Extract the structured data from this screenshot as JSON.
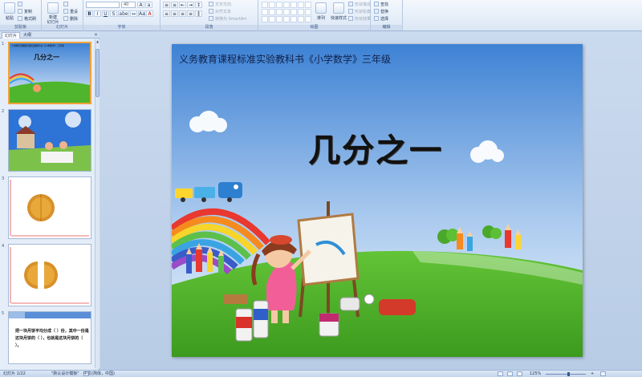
{
  "ribbon": {
    "clipboard": {
      "paste": "粘贴",
      "copy": "复制",
      "format_painter": "格式刷",
      "label": "剪贴板"
    },
    "slides": {
      "new_slide": "新建\n幻灯片",
      "delete": "删除",
      "reset": "重设",
      "label": "幻灯片"
    },
    "font": {
      "size": "40",
      "label": "字体",
      "bold": "B",
      "italic": "I",
      "underline": "U",
      "shadow": "S",
      "strike": "abe",
      "color": "A"
    },
    "paragraph": {
      "text_direction": "文字方向",
      "align_text": "对齐文本",
      "smartart": "转换为 SmartArt",
      "label": "段落"
    },
    "drawing": {
      "arrange": "排列",
      "quick_styles": "快速样式",
      "shape_fill": "形状填充",
      "shape_outline": "形状轮廓",
      "shape_effects": "形状效果",
      "label": "绘图"
    },
    "editing": {
      "find": "查找",
      "replace": "替换",
      "select": "选择",
      "label": "编辑"
    }
  },
  "left_pane": {
    "tab_slides": "幻灯片",
    "tab_outline": "大纲",
    "close": "×",
    "thumbnails": [
      {
        "number": "1",
        "title": "几分之一",
        "subtitle": "义务教育课程标准实验教科书《小学数学》三年级"
      },
      {
        "number": "2"
      },
      {
        "number": "3"
      },
      {
        "number": "4"
      },
      {
        "number": "5",
        "text": "把一块月饼平均分成（ ）份，其中一份是这块月饼的（ ），也就是这块月饼的（ ）。"
      }
    ]
  },
  "slide": {
    "subtitle": "义务教育课程标准实验教科书《小学数学》三年级",
    "title": "几分之一"
  },
  "status_bar": {
    "slide_counter": "幻灯片 1/22",
    "theme": "\"默认设计模板\"",
    "language": "中文(简体，中国)",
    "zoom": "125%"
  },
  "colors": {
    "sky_top": "#3e82d4",
    "sky_bottom": "#e9f2fb",
    "grass": "#4fb52c",
    "selection": "#f2a33a"
  }
}
